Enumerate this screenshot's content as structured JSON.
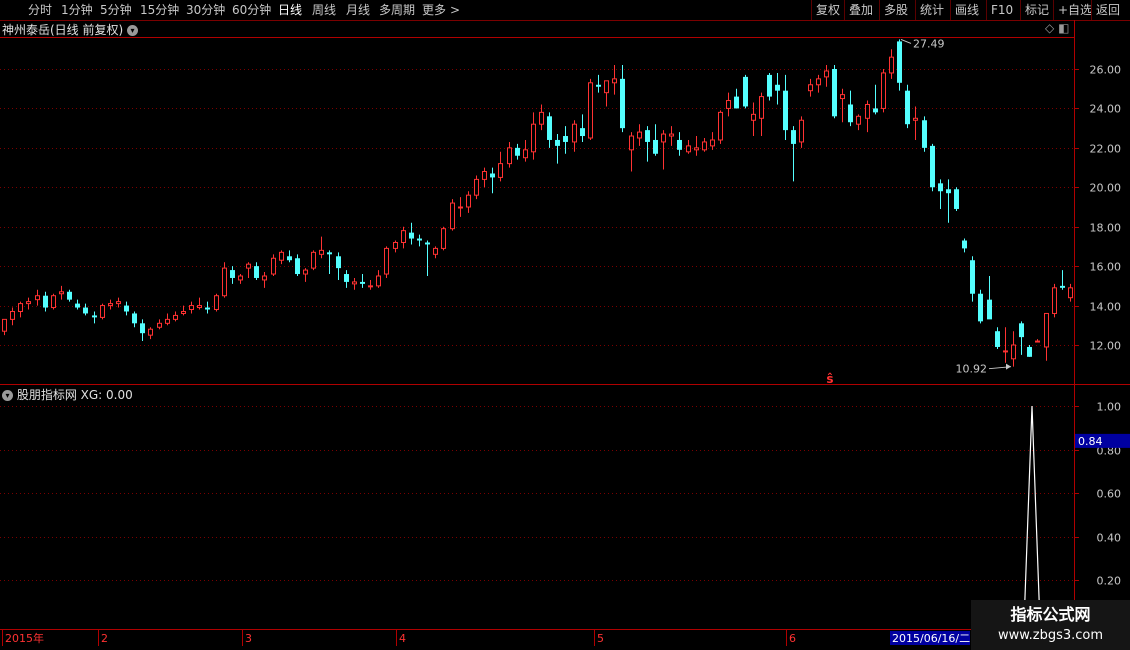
{
  "toolbar": {
    "left_items": [
      {
        "label": "分时",
        "x": 28
      },
      {
        "label": "1分钟",
        "x": 61
      },
      {
        "label": "5分钟",
        "x": 100
      },
      {
        "label": "15分钟",
        "x": 140
      },
      {
        "label": "30分钟",
        "x": 186
      },
      {
        "label": "60分钟",
        "x": 232
      },
      {
        "label": "日线",
        "x": 278,
        "active": true
      },
      {
        "label": "周线",
        "x": 312
      },
      {
        "label": "月线",
        "x": 346
      },
      {
        "label": "多周期",
        "x": 379
      },
      {
        "label": "更多",
        "x": 422
      },
      {
        "label": ">",
        "x": 450
      }
    ],
    "right_items": [
      {
        "label": "复权",
        "x": 816
      },
      {
        "label": "叠加",
        "x": 849
      },
      {
        "label": "多股",
        "x": 884
      },
      {
        "label": "统计",
        "x": 920
      },
      {
        "label": "画线",
        "x": 955
      },
      {
        "label": "F10",
        "x": 991
      },
      {
        "label": "标记",
        "x": 1025
      },
      {
        "label": "+自选",
        "x": 1058
      },
      {
        "label": "返回",
        "x": 1096
      }
    ]
  },
  "main_header": {
    "label": "神州泰岳(日线 前复权)",
    "toggle_icon": "chevron-down-icon"
  },
  "indicator_header": {
    "label": "股朋指标网 XG: 0.00",
    "toggle_icon": "chevron-down-icon"
  },
  "watermark": {
    "line1": "指标公式网",
    "line2": "www.zbgs3.com"
  },
  "colors": {
    "up": "#ff3232",
    "down": "#54ffff",
    "grid": "#7a0000",
    "axis_text": "#c8c8c8",
    "frame": "#b00000",
    "indicator_line": "#ffffff",
    "highlight_bg": "#0000a0"
  },
  "chart_data": [
    {
      "type": "candlestick",
      "title": "神州泰岳(日线 前复权)",
      "ylim": [
        10.5,
        27.8
      ],
      "yticks": [
        "12.00",
        "14.00",
        "16.00",
        "18.00",
        "20.00",
        "22.00",
        "24.00",
        "26.00"
      ],
      "annotations": {
        "high_label": "27.49",
        "low_label": "10.92",
        "signal_marker": "ŝ"
      },
      "x_axis_labels": [
        "2015年",
        "2",
        "3",
        "4",
        "5",
        "6",
        "2015/06/16/二"
      ],
      "candles": [
        [
          12.7,
          13.3,
          12.5,
          13.3
        ],
        [
          13.3,
          13.9,
          13.0,
          13.7
        ],
        [
          13.7,
          14.2,
          13.4,
          14.1
        ],
        [
          14.1,
          14.4,
          13.8,
          14.2
        ],
        [
          14.3,
          14.8,
          14.0,
          14.5
        ],
        [
          14.5,
          14.7,
          13.7,
          13.9
        ],
        [
          13.9,
          14.6,
          13.8,
          14.5
        ],
        [
          14.6,
          15.0,
          14.3,
          14.7
        ],
        [
          14.7,
          14.8,
          14.2,
          14.3
        ],
        [
          14.1,
          14.3,
          13.8,
          13.9
        ],
        [
          13.9,
          14.1,
          13.5,
          13.6
        ],
        [
          13.5,
          13.7,
          13.1,
          13.4
        ],
        [
          13.4,
          14.1,
          13.3,
          14.0
        ],
        [
          14.0,
          14.3,
          13.8,
          14.1
        ],
        [
          14.1,
          14.4,
          13.9,
          14.2
        ],
        [
          14.0,
          14.2,
          13.5,
          13.7
        ],
        [
          13.6,
          13.7,
          12.9,
          13.1
        ],
        [
          13.1,
          13.3,
          12.2,
          12.6
        ],
        [
          12.5,
          12.9,
          12.3,
          12.8
        ],
        [
          12.9,
          13.3,
          12.8,
          13.1
        ],
        [
          13.1,
          13.6,
          13.0,
          13.3
        ],
        [
          13.3,
          13.7,
          13.2,
          13.5
        ],
        [
          13.6,
          14.0,
          13.5,
          13.7
        ],
        [
          13.8,
          14.2,
          13.6,
          14.0
        ],
        [
          13.9,
          14.4,
          13.8,
          14.0
        ],
        [
          13.9,
          14.2,
          13.6,
          13.8
        ],
        [
          13.8,
          14.6,
          13.7,
          14.5
        ],
        [
          14.5,
          16.2,
          14.4,
          15.9
        ],
        [
          15.8,
          16.0,
          15.1,
          15.4
        ],
        [
          15.3,
          15.6,
          15.1,
          15.5
        ],
        [
          15.9,
          16.2,
          15.4,
          16.1
        ],
        [
          16.0,
          16.2,
          15.3,
          15.4
        ],
        [
          15.3,
          15.7,
          14.9,
          15.5
        ],
        [
          15.6,
          16.6,
          15.5,
          16.4
        ],
        [
          16.3,
          16.8,
          16.1,
          16.7
        ],
        [
          16.5,
          16.8,
          16.2,
          16.3
        ],
        [
          16.4,
          16.6,
          15.5,
          15.6
        ],
        [
          15.6,
          15.9,
          15.2,
          15.8
        ],
        [
          15.9,
          16.8,
          15.8,
          16.7
        ],
        [
          16.6,
          17.5,
          16.4,
          16.8
        ],
        [
          16.7,
          16.8,
          15.6,
          16.6
        ],
        [
          16.5,
          16.7,
          15.3,
          15.9
        ],
        [
          15.6,
          15.8,
          14.9,
          15.2
        ],
        [
          15.1,
          15.4,
          14.8,
          15.2
        ],
        [
          15.2,
          15.6,
          14.9,
          15.1
        ],
        [
          15.0,
          15.3,
          14.8,
          15.0
        ],
        [
          15.0,
          15.8,
          14.9,
          15.5
        ],
        [
          15.6,
          17.0,
          15.4,
          16.9
        ],
        [
          16.9,
          17.3,
          16.7,
          17.2
        ],
        [
          17.2,
          18.0,
          16.9,
          17.8
        ],
        [
          17.7,
          18.2,
          17.1,
          17.4
        ],
        [
          17.4,
          17.6,
          17.0,
          17.3
        ],
        [
          17.2,
          17.3,
          15.5,
          17.1
        ],
        [
          16.6,
          17.0,
          16.4,
          16.9
        ],
        [
          16.9,
          18.0,
          16.8,
          17.9
        ],
        [
          17.9,
          19.4,
          17.8,
          19.2
        ],
        [
          19.0,
          19.5,
          18.5,
          19.0
        ],
        [
          19.0,
          19.8,
          18.7,
          19.6
        ],
        [
          19.6,
          20.6,
          19.4,
          20.4
        ],
        [
          20.4,
          21.0,
          20.0,
          20.8
        ],
        [
          20.7,
          21.0,
          19.7,
          20.5
        ],
        [
          20.5,
          21.8,
          20.3,
          21.2
        ],
        [
          21.2,
          22.3,
          21.0,
          22.0
        ],
        [
          22.0,
          22.2,
          21.4,
          21.6
        ],
        [
          21.5,
          22.4,
          21.3,
          21.9
        ],
        [
          21.8,
          23.8,
          21.4,
          23.2
        ],
        [
          23.2,
          24.2,
          22.9,
          23.8
        ],
        [
          23.6,
          23.8,
          22.0,
          22.4
        ],
        [
          22.4,
          22.7,
          21.2,
          22.1
        ],
        [
          22.6,
          23.1,
          21.7,
          22.3
        ],
        [
          22.3,
          23.4,
          21.8,
          23.2
        ],
        [
          23.0,
          23.7,
          22.3,
          22.6
        ],
        [
          22.5,
          25.5,
          22.4,
          25.3
        ],
        [
          25.2,
          25.7,
          24.8,
          25.1
        ],
        [
          24.8,
          25.4,
          24.1,
          25.4
        ],
        [
          25.3,
          26.2,
          24.7,
          25.5
        ],
        [
          25.5,
          26.2,
          22.8,
          23.0
        ],
        [
          21.9,
          22.8,
          20.8,
          22.6
        ],
        [
          22.5,
          23.2,
          22.1,
          22.8
        ],
        [
          22.9,
          23.1,
          21.3,
          22.3
        ],
        [
          22.4,
          23.2,
          21.6,
          21.7
        ],
        [
          22.3,
          22.9,
          20.9,
          22.7
        ],
        [
          22.6,
          23.1,
          22.1,
          22.7
        ],
        [
          22.4,
          22.8,
          21.6,
          21.9
        ],
        [
          21.8,
          22.4,
          21.7,
          22.1
        ],
        [
          21.9,
          22.6,
          21.6,
          22.0
        ],
        [
          21.9,
          22.5,
          21.8,
          22.3
        ],
        [
          22.1,
          22.8,
          21.9,
          22.4
        ],
        [
          22.4,
          23.9,
          22.2,
          23.8
        ],
        [
          24.0,
          24.8,
          23.6,
          24.4
        ],
        [
          24.6,
          25.0,
          24.2,
          24.0
        ],
        [
          25.6,
          25.7,
          24.0,
          24.1
        ],
        [
          23.4,
          24.3,
          22.6,
          23.7
        ],
        [
          23.5,
          24.8,
          22.6,
          24.6
        ],
        [
          25.7,
          25.8,
          24.4,
          24.6
        ],
        [
          25.2,
          25.8,
          24.2,
          24.9
        ],
        [
          24.9,
          25.7,
          22.4,
          22.9
        ],
        [
          22.9,
          23.1,
          20.3,
          22.2
        ],
        [
          22.3,
          23.6,
          22.0,
          23.4
        ],
        [
          24.9,
          25.5,
          24.6,
          25.2
        ],
        [
          25.2,
          25.7,
          24.8,
          25.5
        ],
        [
          25.6,
          26.2,
          25.1,
          25.9
        ],
        [
          26.0,
          26.2,
          23.5,
          23.6
        ],
        [
          24.5,
          25.0,
          23.3,
          24.7
        ],
        [
          24.2,
          24.9,
          23.1,
          23.3
        ],
        [
          23.2,
          23.7,
          22.9,
          23.6
        ],
        [
          23.5,
          24.4,
          22.8,
          24.2
        ],
        [
          24.0,
          25.2,
          23.7,
          23.8
        ],
        [
          24.0,
          26.0,
          23.8,
          25.8
        ],
        [
          25.8,
          27.0,
          25.5,
          26.6
        ],
        [
          27.4,
          27.5,
          24.9,
          25.3
        ],
        [
          24.9,
          25.2,
          23.0,
          23.2
        ],
        [
          23.4,
          24.1,
          22.4,
          23.5
        ],
        [
          23.4,
          23.6,
          21.8,
          22.0
        ],
        [
          22.1,
          22.2,
          19.8,
          20.0
        ],
        [
          20.2,
          20.4,
          18.9,
          19.8
        ],
        [
          19.9,
          20.4,
          18.2,
          19.7
        ],
        [
          19.9,
          20.0,
          18.8,
          18.9
        ],
        [
          17.3,
          17.4,
          16.7,
          16.9
        ],
        [
          16.3,
          16.5,
          14.2,
          14.6
        ],
        [
          14.6,
          14.8,
          13.1,
          13.2
        ],
        [
          14.3,
          15.5,
          14.0,
          13.3
        ],
        [
          12.7,
          12.9,
          11.8,
          11.9
        ],
        [
          11.7,
          12.9,
          11.1,
          11.7
        ],
        [
          11.3,
          12.7,
          10.9,
          12.0
        ],
        [
          13.1,
          13.2,
          11.5,
          12.4
        ],
        [
          11.9,
          12.0,
          11.4,
          11.4
        ],
        [
          12.2,
          12.3,
          12.2,
          12.2
        ],
        [
          11.9,
          13.6,
          11.2,
          13.6
        ],
        [
          13.6,
          15.1,
          13.4,
          14.9
        ],
        [
          15.0,
          15.8,
          14.8,
          14.9
        ],
        [
          14.4,
          15.1,
          14.2,
          14.9
        ]
      ]
    },
    {
      "type": "line",
      "title": "股朋指标网 XG: 0.00",
      "ylim": [
        0,
        1
      ],
      "yticks": [
        "0.20",
        "0.40",
        "0.60",
        "0.80",
        "1.00"
      ],
      "cursor_value": "0.84",
      "series": [
        {
          "values": [
            0,
            0,
            1,
            0,
            0
          ]
        }
      ]
    }
  ]
}
